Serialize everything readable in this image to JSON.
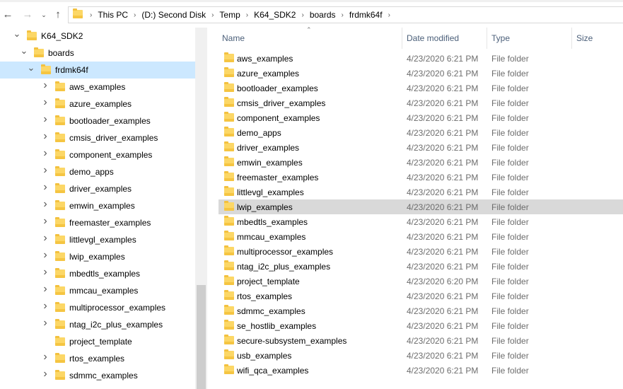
{
  "address_bar": {
    "crumbs": [
      "This PC",
      "(D:) Second Disk",
      "Temp",
      "K64_SDK2",
      "boards",
      "frdmk64f"
    ]
  },
  "header": {
    "name": "Name",
    "date_modified": "Date modified",
    "type": "Type",
    "size": "Size"
  },
  "tree": [
    {
      "label": "K64_SDK2",
      "depth": 0,
      "expanded": true
    },
    {
      "label": "boards",
      "depth": 1,
      "expanded": true
    },
    {
      "label": "frdmk64f",
      "depth": 2,
      "expanded": true,
      "selected": true
    },
    {
      "label": "aws_examples",
      "depth": 3
    },
    {
      "label": "azure_examples",
      "depth": 3
    },
    {
      "label": "bootloader_examples",
      "depth": 3
    },
    {
      "label": "cmsis_driver_examples",
      "depth": 3
    },
    {
      "label": "component_examples",
      "depth": 3
    },
    {
      "label": "demo_apps",
      "depth": 3
    },
    {
      "label": "driver_examples",
      "depth": 3
    },
    {
      "label": "emwin_examples",
      "depth": 3
    },
    {
      "label": "freemaster_examples",
      "depth": 3
    },
    {
      "label": "littlevgl_examples",
      "depth": 3
    },
    {
      "label": "lwip_examples",
      "depth": 3
    },
    {
      "label": "mbedtls_examples",
      "depth": 3
    },
    {
      "label": "mmcau_examples",
      "depth": 3
    },
    {
      "label": "multiprocessor_examples",
      "depth": 3
    },
    {
      "label": "ntag_i2c_plus_examples",
      "depth": 3
    },
    {
      "label": "project_template",
      "depth": 3,
      "no_chevron": true
    },
    {
      "label": "rtos_examples",
      "depth": 3
    },
    {
      "label": "sdmmc_examples",
      "depth": 3
    }
  ],
  "files": [
    {
      "name": "aws_examples",
      "date": "4/23/2020 6:21 PM",
      "type": "File folder"
    },
    {
      "name": "azure_examples",
      "date": "4/23/2020 6:21 PM",
      "type": "File folder"
    },
    {
      "name": "bootloader_examples",
      "date": "4/23/2020 6:21 PM",
      "type": "File folder"
    },
    {
      "name": "cmsis_driver_examples",
      "date": "4/23/2020 6:21 PM",
      "type": "File folder"
    },
    {
      "name": "component_examples",
      "date": "4/23/2020 6:21 PM",
      "type": "File folder"
    },
    {
      "name": "demo_apps",
      "date": "4/23/2020 6:21 PM",
      "type": "File folder"
    },
    {
      "name": "driver_examples",
      "date": "4/23/2020 6:21 PM",
      "type": "File folder"
    },
    {
      "name": "emwin_examples",
      "date": "4/23/2020 6:21 PM",
      "type": "File folder"
    },
    {
      "name": "freemaster_examples",
      "date": "4/23/2020 6:21 PM",
      "type": "File folder"
    },
    {
      "name": "littlevgl_examples",
      "date": "4/23/2020 6:21 PM",
      "type": "File folder"
    },
    {
      "name": "lwip_examples",
      "date": "4/23/2020 6:21 PM",
      "type": "File folder",
      "hover": true
    },
    {
      "name": "mbedtls_examples",
      "date": "4/23/2020 6:21 PM",
      "type": "File folder"
    },
    {
      "name": "mmcau_examples",
      "date": "4/23/2020 6:21 PM",
      "type": "File folder"
    },
    {
      "name": "multiprocessor_examples",
      "date": "4/23/2020 6:21 PM",
      "type": "File folder"
    },
    {
      "name": "ntag_i2c_plus_examples",
      "date": "4/23/2020 6:21 PM",
      "type": "File folder"
    },
    {
      "name": "project_template",
      "date": "4/23/2020 6:20 PM",
      "type": "File folder"
    },
    {
      "name": "rtos_examples",
      "date": "4/23/2020 6:21 PM",
      "type": "File folder"
    },
    {
      "name": "sdmmc_examples",
      "date": "4/23/2020 6:21 PM",
      "type": "File folder"
    },
    {
      "name": "se_hostlib_examples",
      "date": "4/23/2020 6:21 PM",
      "type": "File folder"
    },
    {
      "name": "secure-subsystem_examples",
      "date": "4/23/2020 6:21 PM",
      "type": "File folder"
    },
    {
      "name": "usb_examples",
      "date": "4/23/2020 6:21 PM",
      "type": "File folder"
    },
    {
      "name": "wifi_qca_examples",
      "date": "4/23/2020 6:21 PM",
      "type": "File folder"
    }
  ],
  "icons": {
    "back": "back-arrow-icon",
    "forward": "forward-arrow-icon",
    "recent": "recent-locations-chevron-icon",
    "up": "up-arrow-icon",
    "folder": "folder-icon"
  }
}
